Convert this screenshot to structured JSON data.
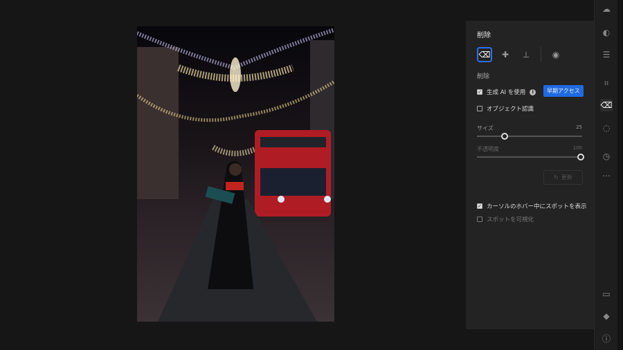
{
  "panel": {
    "title": "削除",
    "tools": [
      {
        "icon": "eraser-icon",
        "active": true
      },
      {
        "icon": "bandage-icon"
      },
      {
        "icon": "stamp-icon"
      },
      {
        "icon": "visualize-spots-icon"
      }
    ],
    "section_label": "削除",
    "use_gen_ai": {
      "label": "生成 AI を使用",
      "checked": true
    },
    "early_access_badge": "早期アクセス",
    "object_detection": {
      "label": "オブジェクト認識",
      "checked": false
    },
    "size": {
      "label": "サイズ",
      "value": "25"
    },
    "opacity": {
      "label": "不透明度",
      "value": "100"
    },
    "refresh_button": "更新",
    "show_spot_on_hover": {
      "label": "カーソルのホバー中にスポットを表示",
      "checked": true
    },
    "visualize_spots": {
      "label": "スポットを可視化",
      "checked": false
    }
  },
  "colors": {
    "accent": "#2d6ff2",
    "badge": "#1f6ae0",
    "panel": "#232323"
  }
}
